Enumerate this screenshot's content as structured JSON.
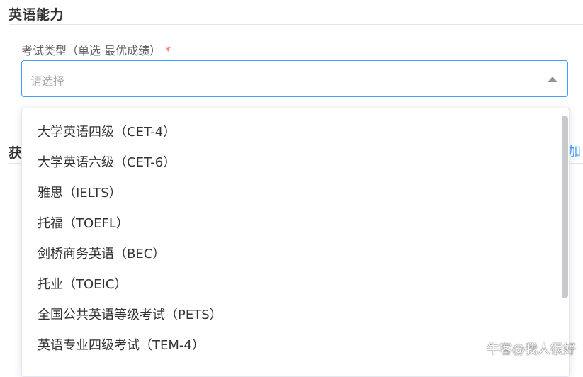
{
  "section": {
    "title": "英语能力"
  },
  "field": {
    "label": "考试类型（单选 最优成绩）",
    "required_mark": "*",
    "placeholder": "请选择"
  },
  "behind": {
    "title_peek": "获",
    "add_link_peek": "加"
  },
  "dropdown": {
    "options": [
      "大学英语四级（CET-4）",
      "大学英语六级（CET-6）",
      "雅思（IELTS）",
      "托福（TOEFL）",
      "剑桥商务英语（BEC）",
      "托业（TOEIC）",
      "全国公共英语等级考试（PETS）",
      "英语专业四级考试（TEM-4）"
    ]
  },
  "watermark": {
    "text": "牛客@我人很好"
  },
  "colors": {
    "accent": "#409eff",
    "required": "#f56c6c",
    "placeholder": "#a8abb2"
  }
}
